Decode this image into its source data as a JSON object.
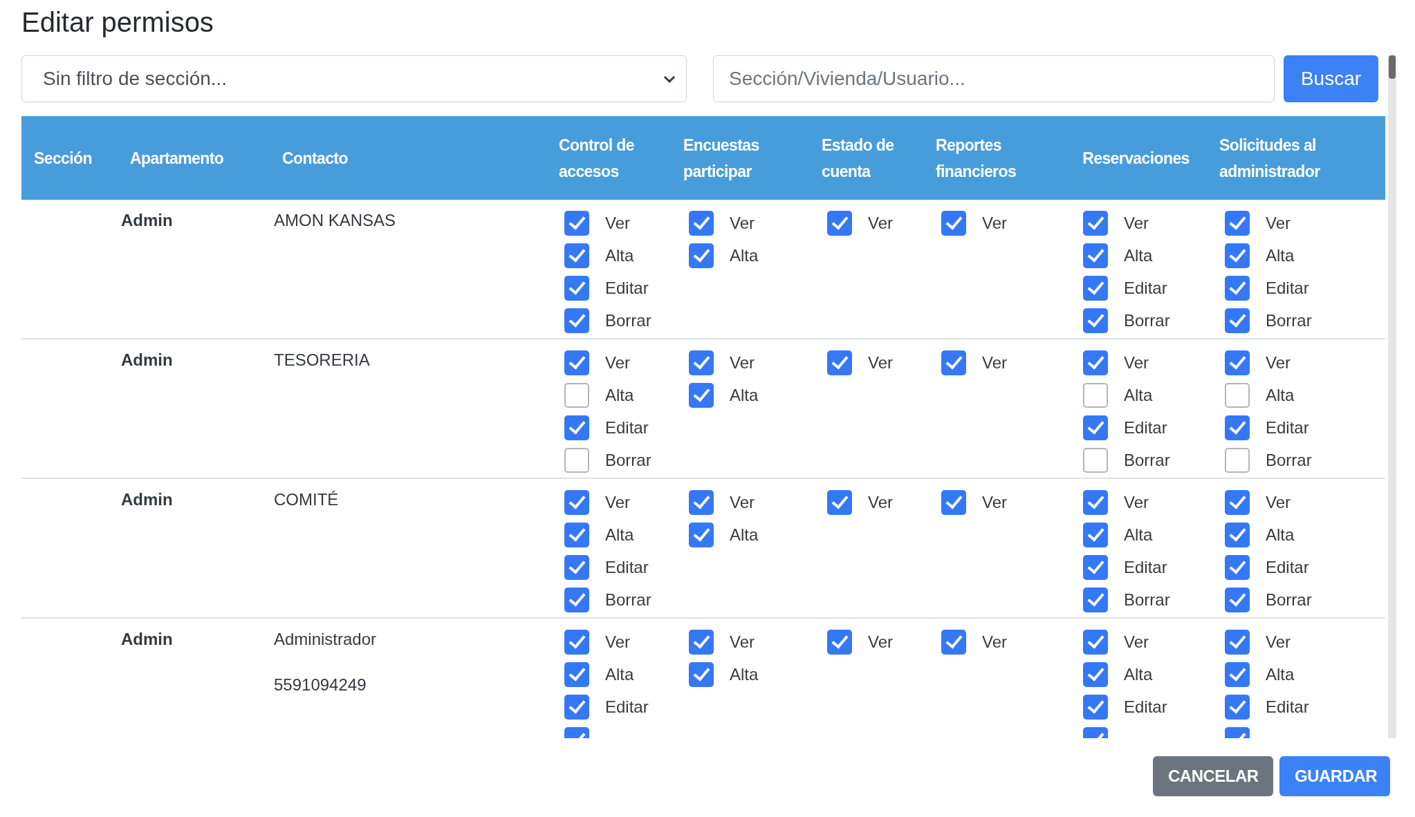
{
  "title": "Editar permisos",
  "section_filter": {
    "value": "Sin filtro de sección..."
  },
  "search": {
    "placeholder": "Sección/Vivienda/Usuario..."
  },
  "search_button": "Buscar",
  "columns": [
    "Sección",
    "Apartamento",
    "Contacto",
    "Control de accesos",
    "Encuestas participar",
    "Estado de cuenta",
    "Reportes financieros",
    "Reservaciones",
    "Solicitudes al administrador"
  ],
  "rows": [
    {
      "apartment": "Admin",
      "contact": [
        "AMON KANSAS"
      ],
      "permissions": [
        [
          {
            "label": "Ver",
            "checked": true
          },
          {
            "label": "Alta",
            "checked": true
          },
          {
            "label": "Editar",
            "checked": true
          },
          {
            "label": "Borrar",
            "checked": true
          }
        ],
        [
          {
            "label": "Ver",
            "checked": true
          },
          {
            "label": "Alta",
            "checked": true
          }
        ],
        [
          {
            "label": "Ver",
            "checked": true
          }
        ],
        [
          {
            "label": "Ver",
            "checked": true
          }
        ],
        [
          {
            "label": "Ver",
            "checked": true
          },
          {
            "label": "Alta",
            "checked": true
          },
          {
            "label": "Editar",
            "checked": true
          },
          {
            "label": "Borrar",
            "checked": true
          }
        ],
        [
          {
            "label": "Ver",
            "checked": true
          },
          {
            "label": "Alta",
            "checked": true
          },
          {
            "label": "Editar",
            "checked": true
          },
          {
            "label": "Borrar",
            "checked": true
          }
        ]
      ]
    },
    {
      "apartment": "Admin",
      "contact": [
        "TESORERIA"
      ],
      "permissions": [
        [
          {
            "label": "Ver",
            "checked": true
          },
          {
            "label": "Alta",
            "checked": false
          },
          {
            "label": "Editar",
            "checked": true
          },
          {
            "label": "Borrar",
            "checked": false
          }
        ],
        [
          {
            "label": "Ver",
            "checked": true
          },
          {
            "label": "Alta",
            "checked": true
          }
        ],
        [
          {
            "label": "Ver",
            "checked": true
          }
        ],
        [
          {
            "label": "Ver",
            "checked": true
          }
        ],
        [
          {
            "label": "Ver",
            "checked": true
          },
          {
            "label": "Alta",
            "checked": false
          },
          {
            "label": "Editar",
            "checked": true
          },
          {
            "label": "Borrar",
            "checked": false
          }
        ],
        [
          {
            "label": "Ver",
            "checked": true
          },
          {
            "label": "Alta",
            "checked": false
          },
          {
            "label": "Editar",
            "checked": true
          },
          {
            "label": "Borrar",
            "checked": false
          }
        ]
      ]
    },
    {
      "apartment": "Admin",
      "contact": [
        "COMITÉ"
      ],
      "permissions": [
        [
          {
            "label": "Ver",
            "checked": true
          },
          {
            "label": "Alta",
            "checked": true
          },
          {
            "label": "Editar",
            "checked": true
          },
          {
            "label": "Borrar",
            "checked": true
          }
        ],
        [
          {
            "label": "Ver",
            "checked": true
          },
          {
            "label": "Alta",
            "checked": true
          }
        ],
        [
          {
            "label": "Ver",
            "checked": true
          }
        ],
        [
          {
            "label": "Ver",
            "checked": true
          }
        ],
        [
          {
            "label": "Ver",
            "checked": true
          },
          {
            "label": "Alta",
            "checked": true
          },
          {
            "label": "Editar",
            "checked": true
          },
          {
            "label": "Borrar",
            "checked": true
          }
        ],
        [
          {
            "label": "Ver",
            "checked": true
          },
          {
            "label": "Alta",
            "checked": true
          },
          {
            "label": "Editar",
            "checked": true
          },
          {
            "label": "Borrar",
            "checked": true
          }
        ]
      ]
    },
    {
      "apartment": "Admin",
      "contact": [
        "Administrador",
        "5591094249"
      ],
      "permissions": [
        [
          {
            "label": "Ver",
            "checked": true
          },
          {
            "label": "Alta",
            "checked": true
          },
          {
            "label": "Editar",
            "checked": true
          },
          {
            "checked": true
          }
        ],
        [
          {
            "label": "Ver",
            "checked": true
          },
          {
            "label": "Alta",
            "checked": true
          }
        ],
        [
          {
            "label": "Ver",
            "checked": true
          }
        ],
        [
          {
            "label": "Ver",
            "checked": true
          }
        ],
        [
          {
            "label": "Ver",
            "checked": true
          },
          {
            "label": "Alta",
            "checked": true
          },
          {
            "label": "Editar",
            "checked": true
          },
          {
            "checked": true
          }
        ],
        [
          {
            "label": "Ver",
            "checked": true
          },
          {
            "label": "Alta",
            "checked": true
          },
          {
            "label": "Editar",
            "checked": true
          },
          {
            "checked": true
          }
        ]
      ]
    }
  ],
  "buttons": [
    {
      "label": "CANCELAR",
      "kind": "secondary"
    },
    {
      "label": "GUARDAR",
      "kind": "primary"
    }
  ]
}
